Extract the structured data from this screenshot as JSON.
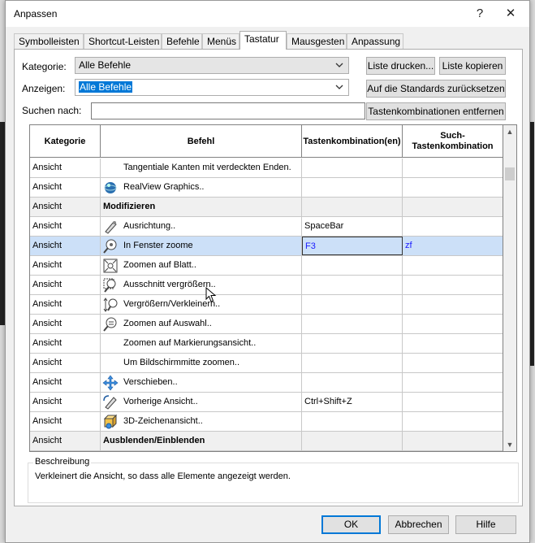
{
  "window": {
    "title": "Anpassen",
    "help_glyph": "?",
    "close_glyph": "✕"
  },
  "tabs": [
    {
      "label": "Symbolleisten"
    },
    {
      "label": "Shortcut-Leisten"
    },
    {
      "label": "Befehle"
    },
    {
      "label": "Menüs"
    },
    {
      "label": "Tastatur"
    },
    {
      "label": "Mausgesten"
    },
    {
      "label": "Anpassung"
    }
  ],
  "active_tab": "Tastatur",
  "filters": {
    "kategorie_label": "Kategorie:",
    "kategorie_value": "Alle Befehle",
    "anzeigen_label": "Anzeigen:",
    "anzeigen_value": "Alle Befehle",
    "suchen_label": "Suchen nach:",
    "suchen_value": ""
  },
  "buttons": {
    "liste_drucken": "Liste drucken...",
    "liste_kopieren": "Liste kopieren",
    "standards": "Auf die Standards zurücksetzen",
    "entfernen": "Tastenkombinationen entfernen"
  },
  "grid": {
    "columns": [
      "Kategorie",
      "Befehl",
      "Tastenkombination(en)",
      "Such-Tastenkombination"
    ],
    "rows": [
      {
        "kategorie": "Ansicht",
        "befehl": "Tangentiale Kanten mit verdeckten Enden.",
        "tasten": "",
        "such": "",
        "icon": "none-icon"
      },
      {
        "kategorie": "Ansicht",
        "befehl": "RealView Graphics..",
        "tasten": "",
        "such": "",
        "icon": "realview-globe-icon"
      },
      {
        "kategorie": "Ansicht",
        "befehl": "Modifizieren",
        "tasten": "",
        "such": "",
        "group": true
      },
      {
        "kategorie": "Ansicht",
        "befehl": "Ausrichtung..",
        "tasten": "SpaceBar",
        "such": "",
        "icon": "orientation-icon"
      },
      {
        "kategorie": "Ansicht",
        "befehl": "In Fenster zoome",
        "tasten": "F3",
        "such": "zf",
        "icon": "zoom-to-fit-icon",
        "selected": true
      },
      {
        "kategorie": "Ansicht",
        "befehl": "Zoomen auf Blatt..",
        "tasten": "",
        "such": "",
        "icon": "zoom-to-sheet-icon"
      },
      {
        "kategorie": "Ansicht",
        "befehl": "Ausschnitt vergrößern..",
        "tasten": "",
        "such": "",
        "icon": "zoom-area-icon"
      },
      {
        "kategorie": "Ansicht",
        "befehl": "Vergrößern/Verkleinern..",
        "tasten": "",
        "such": "",
        "icon": "zoom-in-out-icon"
      },
      {
        "kategorie": "Ansicht",
        "befehl": "Zoomen auf Auswahl..",
        "tasten": "",
        "such": "",
        "icon": "zoom-to-selection-icon"
      },
      {
        "kategorie": "Ansicht",
        "befehl": "Zoomen auf Markierungsansicht..",
        "tasten": "",
        "such": "",
        "icon": "none-icon"
      },
      {
        "kategorie": "Ansicht",
        "befehl": "Um Bildschirmmitte zoomen..",
        "tasten": "",
        "such": "",
        "icon": "none-icon"
      },
      {
        "kategorie": "Ansicht",
        "befehl": "Verschieben..",
        "tasten": "",
        "such": "",
        "icon": "pan-arrows-icon"
      },
      {
        "kategorie": "Ansicht",
        "befehl": "Vorherige Ansicht..",
        "tasten": "Ctrl+Shift+Z",
        "such": "",
        "icon": "previous-view-icon"
      },
      {
        "kategorie": "Ansicht",
        "befehl": "3D-Zeichenansicht..",
        "tasten": "",
        "such": "",
        "icon": "3d-drawing-view-icon"
      },
      {
        "kategorie": "Ansicht",
        "befehl": "Ausblenden/Einblenden",
        "tasten": "",
        "such": "",
        "group": true
      }
    ]
  },
  "description": {
    "legend": "Beschreibung",
    "text": "Verkleinert die Ansicht, so dass alle Elemente angezeigt werden."
  },
  "footer": {
    "ok": "OK",
    "abbrechen": "Abbrechen",
    "hilfe": "Hilfe"
  },
  "colors": {
    "selection": "#cce0f8",
    "accent": "#0078d7",
    "link_blue": "#1a1aff"
  }
}
